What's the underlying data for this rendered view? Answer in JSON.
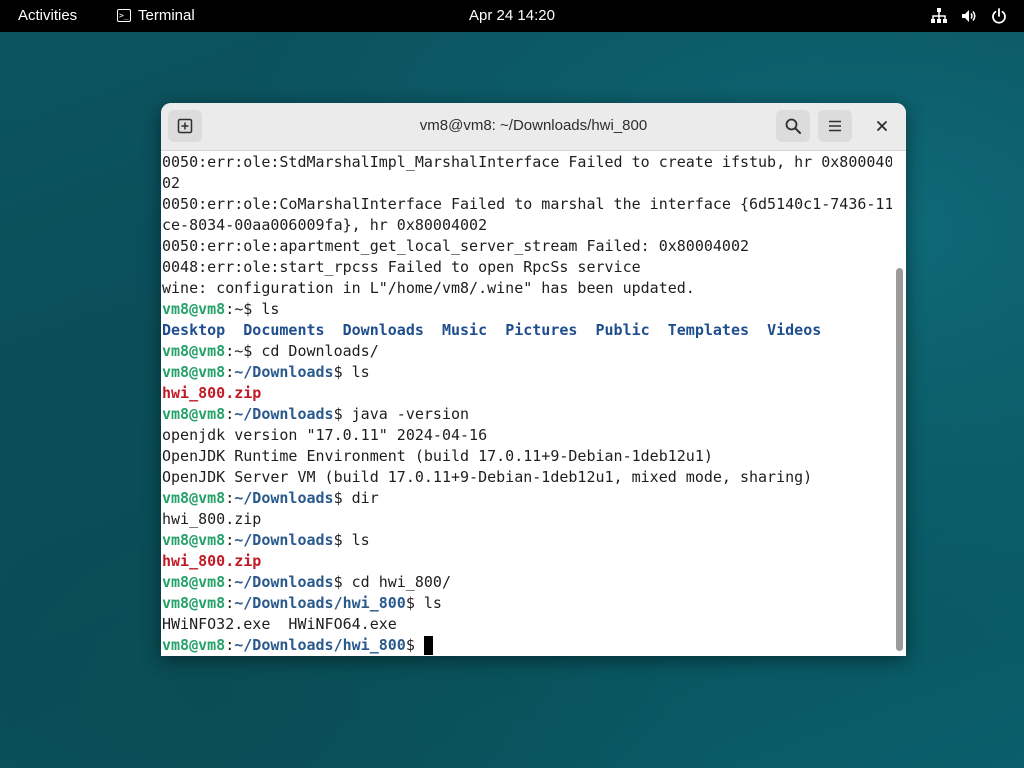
{
  "topbar": {
    "activities": "Activities",
    "app_name": "Terminal",
    "clock": "Apr 24  14:20"
  },
  "window": {
    "title": "vm8@vm8: ~/Downloads/hwi_800"
  },
  "icons": {
    "new_tab": "new-tab-icon",
    "search": "search-icon",
    "menu": "hamburger-menu-icon",
    "close": "close-icon",
    "network": "network-icon",
    "volume": "volume-icon",
    "power": "power-icon"
  },
  "terminal": {
    "lines": [
      [
        {
          "t": "0050:err:ole:StdMarshalImpl_MarshalInterface Failed to create ifstub, hr 0x800040"
        }
      ],
      [
        {
          "t": "02"
        }
      ],
      [
        {
          "t": "0050:err:ole:CoMarshalInterface Failed to marshal the interface {6d5140c1-7436-11"
        }
      ],
      [
        {
          "t": "ce-8034-00aa006009fa}, hr 0x80004002"
        }
      ],
      [
        {
          "t": "0050:err:ole:apartment_get_local_server_stream Failed: 0x80004002"
        }
      ],
      [
        {
          "t": "0048:err:ole:start_rpcss Failed to open RpcSs service"
        }
      ],
      [
        {
          "t": "wine: configuration in L\"/home/vm8/.wine\" has been updated."
        }
      ],
      [
        {
          "t": "vm8@vm8",
          "c": "g"
        },
        {
          "t": ":~$ ls"
        }
      ],
      [
        {
          "t": "Desktop",
          "c": "b2"
        },
        {
          "t": "  "
        },
        {
          "t": "Documents",
          "c": "b2"
        },
        {
          "t": "  "
        },
        {
          "t": "Downloads",
          "c": "b2"
        },
        {
          "t": "  "
        },
        {
          "t": "Music",
          "c": "b2"
        },
        {
          "t": "  "
        },
        {
          "t": "Pictures",
          "c": "b2"
        },
        {
          "t": "  "
        },
        {
          "t": "Public",
          "c": "b2"
        },
        {
          "t": "  "
        },
        {
          "t": "Templates",
          "c": "b2"
        },
        {
          "t": "  "
        },
        {
          "t": "Videos",
          "c": "b2"
        }
      ],
      [
        {
          "t": "vm8@vm8",
          "c": "g"
        },
        {
          "t": ":~$ cd Downloads/"
        }
      ],
      [
        {
          "t": "vm8@vm8",
          "c": "g"
        },
        {
          "t": ":"
        },
        {
          "t": "~/Downloads",
          "c": "b"
        },
        {
          "t": "$ ls"
        }
      ],
      [
        {
          "t": "hwi_800.zip",
          "c": "r"
        }
      ],
      [
        {
          "t": "vm8@vm8",
          "c": "g"
        },
        {
          "t": ":"
        },
        {
          "t": "~/Downloads",
          "c": "b"
        },
        {
          "t": "$ java -version"
        }
      ],
      [
        {
          "t": "openjdk version \"17.0.11\" 2024-04-16"
        }
      ],
      [
        {
          "t": "OpenJDK Runtime Environment (build 17.0.11+9-Debian-1deb12u1)"
        }
      ],
      [
        {
          "t": "OpenJDK Server VM (build 17.0.11+9-Debian-1deb12u1, mixed mode, sharing)"
        }
      ],
      [
        {
          "t": "vm8@vm8",
          "c": "g"
        },
        {
          "t": ":"
        },
        {
          "t": "~/Downloads",
          "c": "b"
        },
        {
          "t": "$ dir"
        }
      ],
      [
        {
          "t": "hwi_800.zip"
        }
      ],
      [
        {
          "t": "vm8@vm8",
          "c": "g"
        },
        {
          "t": ":"
        },
        {
          "t": "~/Downloads",
          "c": "b"
        },
        {
          "t": "$ ls"
        }
      ],
      [
        {
          "t": "hwi_800.zip",
          "c": "r"
        }
      ],
      [
        {
          "t": "vm8@vm8",
          "c": "g"
        },
        {
          "t": ":"
        },
        {
          "t": "~/Downloads",
          "c": "b"
        },
        {
          "t": "$ cd hwi_800/"
        }
      ],
      [
        {
          "t": "vm8@vm8",
          "c": "g"
        },
        {
          "t": ":"
        },
        {
          "t": "~/Downloads/hwi_800",
          "c": "b"
        },
        {
          "t": "$ ls"
        }
      ],
      [
        {
          "t": "HWiNFO32.exe  HWiNFO64.exe"
        }
      ],
      [
        {
          "t": "vm8@vm8",
          "c": "g"
        },
        {
          "t": ":"
        },
        {
          "t": "~/Downloads/hwi_800",
          "c": "b"
        },
        {
          "t": "$ "
        },
        {
          "cursor": true
        }
      ]
    ]
  },
  "colors": {
    "prompt_user": "#26a269",
    "prompt_path": "#2a5a8c",
    "archive_file": "#c01c28",
    "directory": "#1f4e8f"
  }
}
